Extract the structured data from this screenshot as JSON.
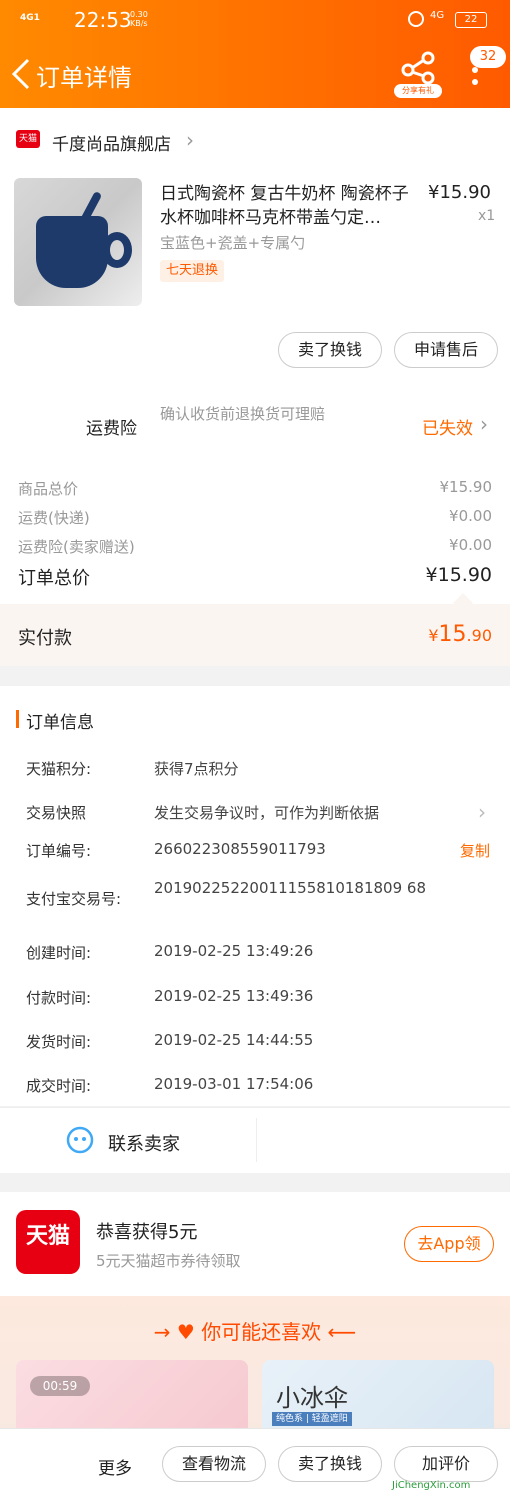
{
  "status_bar": {
    "signal": "4G1",
    "time": "22:53",
    "speed": "0.30",
    "speed_unit": "KB/s",
    "network": "4G",
    "battery": "22"
  },
  "header": {
    "title": "订单详情",
    "share_label": "分享有礼",
    "badge_count": "32"
  },
  "store": {
    "icon_text": "天猫",
    "name": "千度尚品旗舰店"
  },
  "product": {
    "title": "日式陶瓷杯 复古牛奶杯 陶瓷杯子水杯咖啡杯马克杯带盖勺定…",
    "price": "¥15.90",
    "qty": "x1",
    "sku": "宝蓝色+瓷盖+专属勺",
    "tag": "七天退换",
    "btn_sell": "卖了换钱",
    "btn_after_sale": "申请售后"
  },
  "insurance": {
    "label": "运费险",
    "desc": "确认收货前退换货可理赔",
    "status": "已失效"
  },
  "totals": {
    "goods_label": "商品总价",
    "goods_value": "¥15.90",
    "ship_label": "运费(快递)",
    "ship_value": "¥0.00",
    "ins_label": "运费险(卖家赠送)",
    "ins_value": "¥0.00",
    "order_label": "订单总价",
    "order_value": "¥15.90",
    "paid_label": "实付款",
    "paid_currency": "¥",
    "paid_int": "15",
    "paid_dec": ".90"
  },
  "order_info": {
    "section_title": "订单信息",
    "rows": [
      {
        "label": "天猫积分:",
        "value": "获得7点积分"
      },
      {
        "label": "交易快照",
        "value": "发生交易争议时，可作为判断依据"
      },
      {
        "label": "订单编号:",
        "value": "266022308559011793"
      },
      {
        "label": "支付宝交易号:",
        "value": "20190225220011155810181809 68"
      },
      {
        "label": "创建时间:",
        "value": "2019-02-25 13:49:26"
      },
      {
        "label": "付款时间:",
        "value": "2019-02-25 13:49:36"
      },
      {
        "label": "发货时间:",
        "value": "2019-02-25 14:44:55"
      },
      {
        "label": "成交时间:",
        "value": "2019-03-01 17:54:06"
      }
    ],
    "copy_label": "复制"
  },
  "contact": {
    "label": "联系卖家"
  },
  "promo": {
    "icon_text": "天猫",
    "title": "恭喜获得5元",
    "subtitle": "5元天猫超市券待领取",
    "button": "去App领"
  },
  "recommend": {
    "title": "你可能还喜欢",
    "tile1_badge": "00:59",
    "tile2_title": "小冰伞",
    "tile2_tag": "纯色系 | 轻盈遮阳"
  },
  "bottom_bar": {
    "more": "更多",
    "logistics": "查看物流",
    "sell": "卖了换钱",
    "review": "加评价",
    "watermark": "JiChengXin.com"
  }
}
